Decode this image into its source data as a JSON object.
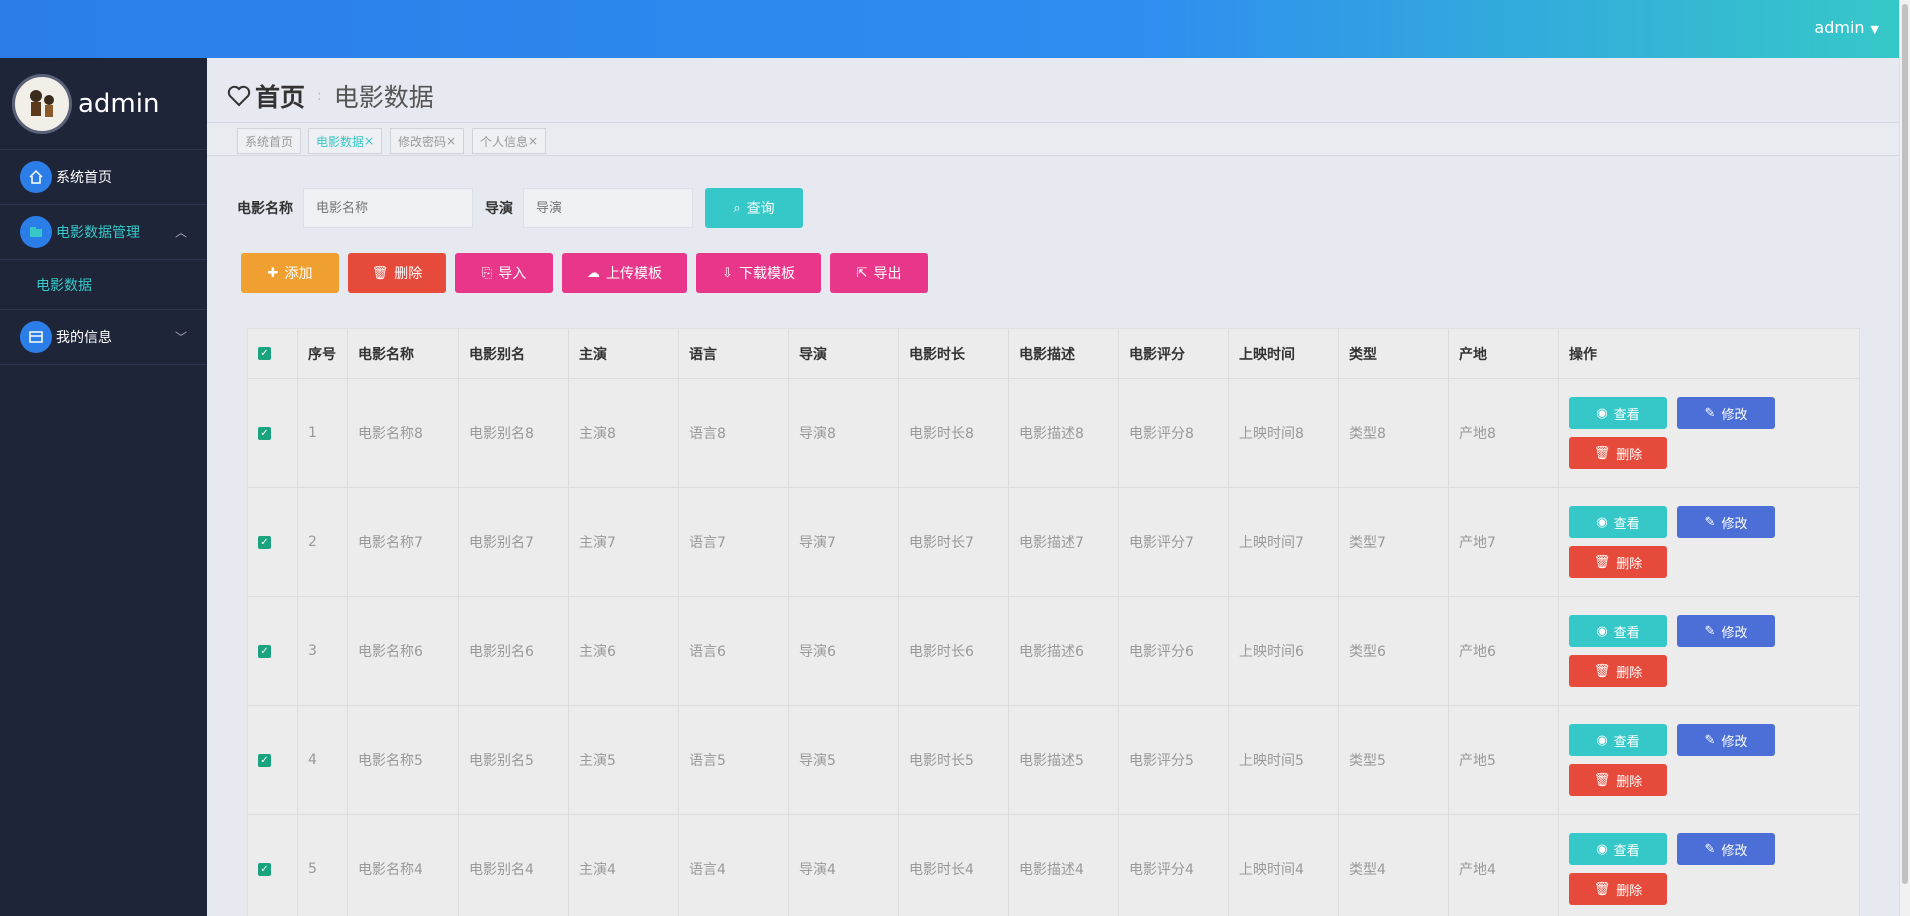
{
  "topbar": {
    "user": "admin"
  },
  "sidebar": {
    "username": "admin",
    "items": [
      {
        "label": "系统首页"
      },
      {
        "label": "电影数据管理",
        "sub": [
          {
            "label": "电影数据"
          }
        ]
      },
      {
        "label": "我的信息"
      }
    ]
  },
  "breadcrumb": {
    "home": "首页",
    "current": "电影数据"
  },
  "tabs": [
    {
      "label": "系统首页",
      "closable": false
    },
    {
      "label": "电影数据",
      "closable": true
    },
    {
      "label": "修改密码",
      "closable": true
    },
    {
      "label": "个人信息",
      "closable": true
    }
  ],
  "search": {
    "name_label": "电影名称",
    "name_placeholder": "电影名称",
    "director_label": "导演",
    "director_placeholder": "导演",
    "query_button": "查询"
  },
  "actions": {
    "add": "添加",
    "delete": "删除",
    "import": "导入",
    "upload_template": "上传模板",
    "download_template": "下载模板",
    "export": "导出"
  },
  "table": {
    "headers": [
      "序号",
      "电影名称",
      "电影别名",
      "主演",
      "语言",
      "导演",
      "电影时长",
      "电影描述",
      "电影评分",
      "上映时间",
      "类型",
      "产地",
      "操作"
    ],
    "rows": [
      [
        "1",
        "电影名称8",
        "电影别名8",
        "主演8",
        "语言8",
        "导演8",
        "电影时长8",
        "电影描述8",
        "电影评分8",
        "上映时间8",
        "类型8",
        "产地8"
      ],
      [
        "2",
        "电影名称7",
        "电影别名7",
        "主演7",
        "语言7",
        "导演7",
        "电影时长7",
        "电影描述7",
        "电影评分7",
        "上映时间7",
        "类型7",
        "产地7"
      ],
      [
        "3",
        "电影名称6",
        "电影别名6",
        "主演6",
        "语言6",
        "导演6",
        "电影时长6",
        "电影描述6",
        "电影评分6",
        "上映时间6",
        "类型6",
        "产地6"
      ],
      [
        "4",
        "电影名称5",
        "电影别名5",
        "主演5",
        "语言5",
        "导演5",
        "电影时长5",
        "电影描述5",
        "电影评分5",
        "上映时间5",
        "类型5",
        "产地5"
      ],
      [
        "5",
        "电影名称4",
        "电影别名4",
        "主演4",
        "语言4",
        "导演4",
        "电影时长4",
        "电影描述4",
        "电影评分4",
        "上映时间4",
        "类型4",
        "产地4"
      ]
    ],
    "row_actions": {
      "view": "查看",
      "edit": "修改",
      "delete": "删除"
    }
  },
  "colors": {
    "primary": "#2b7ee8",
    "accent": "#36c8c8",
    "danger": "#e64a3b",
    "warning": "#f0a030",
    "pink": "#e8378a",
    "edit": "#4b6fd6",
    "sidebar": "#1f2538"
  }
}
